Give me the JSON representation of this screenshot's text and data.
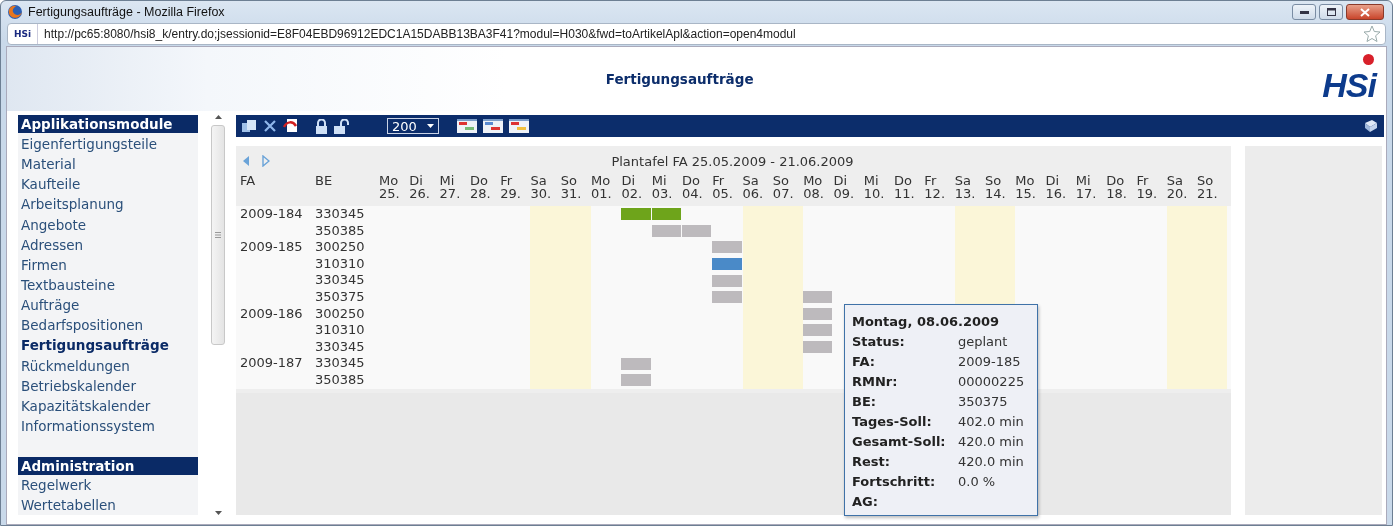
{
  "window": {
    "title": "Fertigungsaufträge - Mozilla Firefox"
  },
  "address_bar": {
    "site_badge": "HSi",
    "url": "http://pc65:8080/hsi8_k/entry.do;jsessionid=E8F04EBD96912EDC1A15DABB13BA3F41?modul=H030&fwd=toArtikelApl&action=open4modul"
  },
  "page": {
    "title": "Fertigungsaufträge",
    "logo": "HSi"
  },
  "sidebar": {
    "sections": [
      {
        "title": "Applikationsmodule",
        "items": [
          {
            "label": "Eigenfertigungsteile",
            "selected": false
          },
          {
            "label": "Material",
            "selected": false
          },
          {
            "label": "Kaufteile",
            "selected": false
          },
          {
            "label": "Arbeitsplanung",
            "selected": false
          },
          {
            "label": "Angebote",
            "selected": false
          },
          {
            "label": "Adressen",
            "selected": false
          },
          {
            "label": "Firmen",
            "selected": false
          },
          {
            "label": "Textbausteine",
            "selected": false
          },
          {
            "label": "Aufträge",
            "selected": false
          },
          {
            "label": "Bedarfspositionen",
            "selected": false
          },
          {
            "label": "Fertigungsaufträge",
            "selected": true
          },
          {
            "label": "Rückmeldungen",
            "selected": false
          },
          {
            "label": "Betriebskalender",
            "selected": false
          },
          {
            "label": "Kapazitätskalender",
            "selected": false
          },
          {
            "label": "Informationssystem",
            "selected": false
          }
        ]
      },
      {
        "title": "Administration",
        "items": [
          {
            "label": "Regelwerk",
            "selected": false
          },
          {
            "label": "Wertetabellen",
            "selected": false
          }
        ]
      }
    ]
  },
  "toolbar": {
    "page_size": "200"
  },
  "plan_board": {
    "title": "Plantafel FA 25.05.2009 - 21.06.2009",
    "columns": [
      "FA",
      "BE"
    ],
    "days": [
      {
        "weekday": "Mo",
        "date": "25.",
        "weekend": false
      },
      {
        "weekday": "Di",
        "date": "26.",
        "weekend": false
      },
      {
        "weekday": "Mi",
        "date": "27.",
        "weekend": false
      },
      {
        "weekday": "Do",
        "date": "28.",
        "weekend": false
      },
      {
        "weekday": "Fr",
        "date": "29.",
        "weekend": false
      },
      {
        "weekday": "Sa",
        "date": "30.",
        "weekend": true
      },
      {
        "weekday": "So",
        "date": "31.",
        "weekend": true
      },
      {
        "weekday": "Mo",
        "date": "01.",
        "weekend": false
      },
      {
        "weekday": "Di",
        "date": "02.",
        "weekend": false
      },
      {
        "weekday": "Mi",
        "date": "03.",
        "weekend": false
      },
      {
        "weekday": "Do",
        "date": "04.",
        "weekend": false
      },
      {
        "weekday": "Fr",
        "date": "05.",
        "weekend": false
      },
      {
        "weekday": "Sa",
        "date": "06.",
        "weekend": true
      },
      {
        "weekday": "So",
        "date": "07.",
        "weekend": true
      },
      {
        "weekday": "Mo",
        "date": "08.",
        "weekend": false
      },
      {
        "weekday": "Di",
        "date": "09.",
        "weekend": false
      },
      {
        "weekday": "Mi",
        "date": "10.",
        "weekend": false
      },
      {
        "weekday": "Do",
        "date": "11.",
        "weekend": false
      },
      {
        "weekday": "Fr",
        "date": "12.",
        "weekend": false
      },
      {
        "weekday": "Sa",
        "date": "13.",
        "weekend": true
      },
      {
        "weekday": "So",
        "date": "14.",
        "weekend": true
      },
      {
        "weekday": "Mo",
        "date": "15.",
        "weekend": false
      },
      {
        "weekday": "Di",
        "date": "16.",
        "weekend": false
      },
      {
        "weekday": "Mi",
        "date": "17.",
        "weekend": false
      },
      {
        "weekday": "Do",
        "date": "18.",
        "weekend": false
      },
      {
        "weekday": "Fr",
        "date": "19.",
        "weekend": false
      },
      {
        "weekday": "Sa",
        "date": "20.",
        "weekend": true
      },
      {
        "weekday": "So",
        "date": "21.",
        "weekend": true
      }
    ],
    "rows": [
      {
        "fa": "2009-184",
        "be": "330345",
        "cells": [
          {
            "kind": "none"
          },
          {
            "kind": "none"
          },
          {
            "kind": "none"
          },
          {
            "kind": "none"
          },
          {
            "kind": "none"
          },
          {
            "kind": "none"
          },
          {
            "kind": "none"
          },
          {
            "kind": "none"
          },
          {
            "kind": "work"
          },
          {
            "kind": "work"
          },
          {
            "kind": "none"
          },
          {
            "kind": "none"
          },
          {
            "kind": "none"
          },
          {
            "kind": "none"
          },
          {
            "kind": "none"
          },
          {
            "kind": "none"
          },
          {
            "kind": "none"
          },
          {
            "kind": "none"
          },
          {
            "kind": "none"
          },
          {
            "kind": "none"
          },
          {
            "kind": "none"
          },
          {
            "kind": "none"
          },
          {
            "kind": "none"
          },
          {
            "kind": "none"
          },
          {
            "kind": "none"
          },
          {
            "kind": "none"
          },
          {
            "kind": "none"
          },
          {
            "kind": "none"
          }
        ]
      },
      {
        "be": "350385",
        "cells": [
          {
            "kind": "none"
          },
          {
            "kind": "none"
          },
          {
            "kind": "none"
          },
          {
            "kind": "none"
          },
          {
            "kind": "none"
          },
          {
            "kind": "none"
          },
          {
            "kind": "none"
          },
          {
            "kind": "none"
          },
          {
            "kind": "none"
          },
          {
            "kind": "plan"
          },
          {
            "kind": "plan"
          },
          {
            "kind": "none"
          },
          {
            "kind": "none"
          },
          {
            "kind": "none"
          },
          {
            "kind": "none"
          },
          {
            "kind": "none"
          },
          {
            "kind": "none"
          },
          {
            "kind": "none"
          },
          {
            "kind": "none"
          },
          {
            "kind": "none"
          },
          {
            "kind": "none"
          },
          {
            "kind": "none"
          },
          {
            "kind": "none"
          },
          {
            "kind": "none"
          },
          {
            "kind": "none"
          },
          {
            "kind": "none"
          },
          {
            "kind": "none"
          },
          {
            "kind": "none"
          }
        ]
      },
      {
        "fa": "2009-185",
        "be": "300250",
        "cells": [
          {
            "kind": "none"
          },
          {
            "kind": "none"
          },
          {
            "kind": "none"
          },
          {
            "kind": "none"
          },
          {
            "kind": "none"
          },
          {
            "kind": "none"
          },
          {
            "kind": "none"
          },
          {
            "kind": "none"
          },
          {
            "kind": "none"
          },
          {
            "kind": "none"
          },
          {
            "kind": "none"
          },
          {
            "kind": "plan"
          },
          {
            "kind": "none"
          },
          {
            "kind": "none"
          },
          {
            "kind": "none"
          },
          {
            "kind": "none"
          },
          {
            "kind": "none"
          },
          {
            "kind": "none"
          },
          {
            "kind": "none"
          },
          {
            "kind": "none"
          },
          {
            "kind": "none"
          },
          {
            "kind": "none"
          },
          {
            "kind": "none"
          },
          {
            "kind": "none"
          },
          {
            "kind": "none"
          },
          {
            "kind": "none"
          },
          {
            "kind": "none"
          },
          {
            "kind": "none"
          }
        ]
      },
      {
        "be": "310310",
        "cells": [
          {
            "kind": "none"
          },
          {
            "kind": "none"
          },
          {
            "kind": "none"
          },
          {
            "kind": "none"
          },
          {
            "kind": "none"
          },
          {
            "kind": "none"
          },
          {
            "kind": "none"
          },
          {
            "kind": "none"
          },
          {
            "kind": "none"
          },
          {
            "kind": "none"
          },
          {
            "kind": "none"
          },
          {
            "kind": "mark"
          },
          {
            "kind": "none"
          },
          {
            "kind": "none"
          },
          {
            "kind": "none"
          },
          {
            "kind": "none"
          },
          {
            "kind": "none"
          },
          {
            "kind": "none"
          },
          {
            "kind": "none"
          },
          {
            "kind": "none"
          },
          {
            "kind": "none"
          },
          {
            "kind": "none"
          },
          {
            "kind": "none"
          },
          {
            "kind": "none"
          },
          {
            "kind": "none"
          },
          {
            "kind": "none"
          },
          {
            "kind": "none"
          },
          {
            "kind": "none"
          }
        ]
      },
      {
        "be": "330345",
        "cells": [
          {
            "kind": "none"
          },
          {
            "kind": "none"
          },
          {
            "kind": "none"
          },
          {
            "kind": "none"
          },
          {
            "kind": "none"
          },
          {
            "kind": "none"
          },
          {
            "kind": "none"
          },
          {
            "kind": "none"
          },
          {
            "kind": "none"
          },
          {
            "kind": "none"
          },
          {
            "kind": "none"
          },
          {
            "kind": "plan"
          },
          {
            "kind": "none"
          },
          {
            "kind": "none"
          },
          {
            "kind": "none"
          },
          {
            "kind": "none"
          },
          {
            "kind": "none"
          },
          {
            "kind": "none"
          },
          {
            "kind": "none"
          },
          {
            "kind": "none"
          },
          {
            "kind": "none"
          },
          {
            "kind": "none"
          },
          {
            "kind": "none"
          },
          {
            "kind": "none"
          },
          {
            "kind": "none"
          },
          {
            "kind": "none"
          },
          {
            "kind": "none"
          },
          {
            "kind": "none"
          }
        ]
      },
      {
        "be": "350375",
        "cells": [
          {
            "kind": "none"
          },
          {
            "kind": "none"
          },
          {
            "kind": "none"
          },
          {
            "kind": "none"
          },
          {
            "kind": "none"
          },
          {
            "kind": "none"
          },
          {
            "kind": "none"
          },
          {
            "kind": "none"
          },
          {
            "kind": "none"
          },
          {
            "kind": "none"
          },
          {
            "kind": "none"
          },
          {
            "kind": "plan"
          },
          {
            "kind": "none"
          },
          {
            "kind": "none"
          },
          {
            "kind": "plan"
          },
          {
            "kind": "none"
          },
          {
            "kind": "none"
          },
          {
            "kind": "none"
          },
          {
            "kind": "none"
          },
          {
            "kind": "none"
          },
          {
            "kind": "none"
          },
          {
            "kind": "none"
          },
          {
            "kind": "none"
          },
          {
            "kind": "none"
          },
          {
            "kind": "none"
          },
          {
            "kind": "none"
          },
          {
            "kind": "none"
          },
          {
            "kind": "none"
          }
        ]
      },
      {
        "fa": "2009-186",
        "be": "300250",
        "cells": [
          {
            "kind": "none"
          },
          {
            "kind": "none"
          },
          {
            "kind": "none"
          },
          {
            "kind": "none"
          },
          {
            "kind": "none"
          },
          {
            "kind": "none"
          },
          {
            "kind": "none"
          },
          {
            "kind": "none"
          },
          {
            "kind": "none"
          },
          {
            "kind": "none"
          },
          {
            "kind": "none"
          },
          {
            "kind": "none"
          },
          {
            "kind": "none"
          },
          {
            "kind": "none"
          },
          {
            "kind": "plan"
          },
          {
            "kind": "none"
          },
          {
            "kind": "none"
          },
          {
            "kind": "none"
          },
          {
            "kind": "none"
          },
          {
            "kind": "none"
          },
          {
            "kind": "none"
          },
          {
            "kind": "none"
          },
          {
            "kind": "none"
          },
          {
            "kind": "none"
          },
          {
            "kind": "none"
          },
          {
            "kind": "none"
          },
          {
            "kind": "none"
          },
          {
            "kind": "none"
          }
        ]
      },
      {
        "be": "310310",
        "cells": [
          {
            "kind": "none"
          },
          {
            "kind": "none"
          },
          {
            "kind": "none"
          },
          {
            "kind": "none"
          },
          {
            "kind": "none"
          },
          {
            "kind": "none"
          },
          {
            "kind": "none"
          },
          {
            "kind": "none"
          },
          {
            "kind": "none"
          },
          {
            "kind": "none"
          },
          {
            "kind": "none"
          },
          {
            "kind": "none"
          },
          {
            "kind": "none"
          },
          {
            "kind": "none"
          },
          {
            "kind": "plan"
          },
          {
            "kind": "none"
          },
          {
            "kind": "none"
          },
          {
            "kind": "none"
          },
          {
            "kind": "none"
          },
          {
            "kind": "none"
          },
          {
            "kind": "none"
          },
          {
            "kind": "none"
          },
          {
            "kind": "none"
          },
          {
            "kind": "none"
          },
          {
            "kind": "none"
          },
          {
            "kind": "none"
          },
          {
            "kind": "none"
          },
          {
            "kind": "none"
          }
        ]
      },
      {
        "be": "330345",
        "cells": [
          {
            "kind": "none"
          },
          {
            "kind": "none"
          },
          {
            "kind": "none"
          },
          {
            "kind": "none"
          },
          {
            "kind": "none"
          },
          {
            "kind": "none"
          },
          {
            "kind": "none"
          },
          {
            "kind": "none"
          },
          {
            "kind": "none"
          },
          {
            "kind": "none"
          },
          {
            "kind": "none"
          },
          {
            "kind": "none"
          },
          {
            "kind": "none"
          },
          {
            "kind": "none"
          },
          {
            "kind": "plan"
          },
          {
            "kind": "none"
          },
          {
            "kind": "none"
          },
          {
            "kind": "none"
          },
          {
            "kind": "none"
          },
          {
            "kind": "none"
          },
          {
            "kind": "none"
          },
          {
            "kind": "none"
          },
          {
            "kind": "none"
          },
          {
            "kind": "none"
          },
          {
            "kind": "none"
          },
          {
            "kind": "none"
          },
          {
            "kind": "none"
          },
          {
            "kind": "none"
          }
        ]
      },
      {
        "fa": "2009-187",
        "be": "330345",
        "cells": [
          {
            "kind": "none"
          },
          {
            "kind": "none"
          },
          {
            "kind": "none"
          },
          {
            "kind": "none"
          },
          {
            "kind": "none"
          },
          {
            "kind": "none"
          },
          {
            "kind": "none"
          },
          {
            "kind": "none"
          },
          {
            "kind": "plan"
          },
          {
            "kind": "none"
          },
          {
            "kind": "none"
          },
          {
            "kind": "none"
          },
          {
            "kind": "none"
          },
          {
            "kind": "none"
          },
          {
            "kind": "none"
          },
          {
            "kind": "none"
          },
          {
            "kind": "none"
          },
          {
            "kind": "none"
          },
          {
            "kind": "none"
          },
          {
            "kind": "none"
          },
          {
            "kind": "none"
          },
          {
            "kind": "none"
          },
          {
            "kind": "none"
          },
          {
            "kind": "none"
          },
          {
            "kind": "none"
          },
          {
            "kind": "none"
          },
          {
            "kind": "none"
          },
          {
            "kind": "none"
          }
        ]
      },
      {
        "be": "350385",
        "cells": [
          {
            "kind": "none"
          },
          {
            "kind": "none"
          },
          {
            "kind": "none"
          },
          {
            "kind": "none"
          },
          {
            "kind": "none"
          },
          {
            "kind": "none"
          },
          {
            "kind": "none"
          },
          {
            "kind": "none"
          },
          {
            "kind": "plan"
          },
          {
            "kind": "none"
          },
          {
            "kind": "none"
          },
          {
            "kind": "none"
          },
          {
            "kind": "none"
          },
          {
            "kind": "none"
          },
          {
            "kind": "none"
          },
          {
            "kind": "none"
          },
          {
            "kind": "none"
          },
          {
            "kind": "none"
          },
          {
            "kind": "none"
          },
          {
            "kind": "none"
          },
          {
            "kind": "none"
          },
          {
            "kind": "none"
          },
          {
            "kind": "none"
          },
          {
            "kind": "none"
          },
          {
            "kind": "none"
          },
          {
            "kind": "none"
          },
          {
            "kind": "none"
          },
          {
            "kind": "none"
          }
        ]
      }
    ]
  },
  "tooltip": {
    "title": "Montag, 08.06.2009",
    "fields": [
      {
        "label": "Status:",
        "value": "geplant"
      },
      {
        "label": "FA:",
        "value": "2009-185"
      },
      {
        "label": "RMNr:",
        "value": "00000225"
      },
      {
        "label": "BE:",
        "value": "350375"
      },
      {
        "label": "Tages-Soll:",
        "value": "402.0 min"
      },
      {
        "label": "Gesamt-Soll:",
        "value": "420.0 min"
      },
      {
        "label": "Rest:",
        "value": "420.0 min"
      },
      {
        "label": "Fortschritt:",
        "value": "0.0 %"
      },
      {
        "label": "AG:"
      }
    ]
  }
}
